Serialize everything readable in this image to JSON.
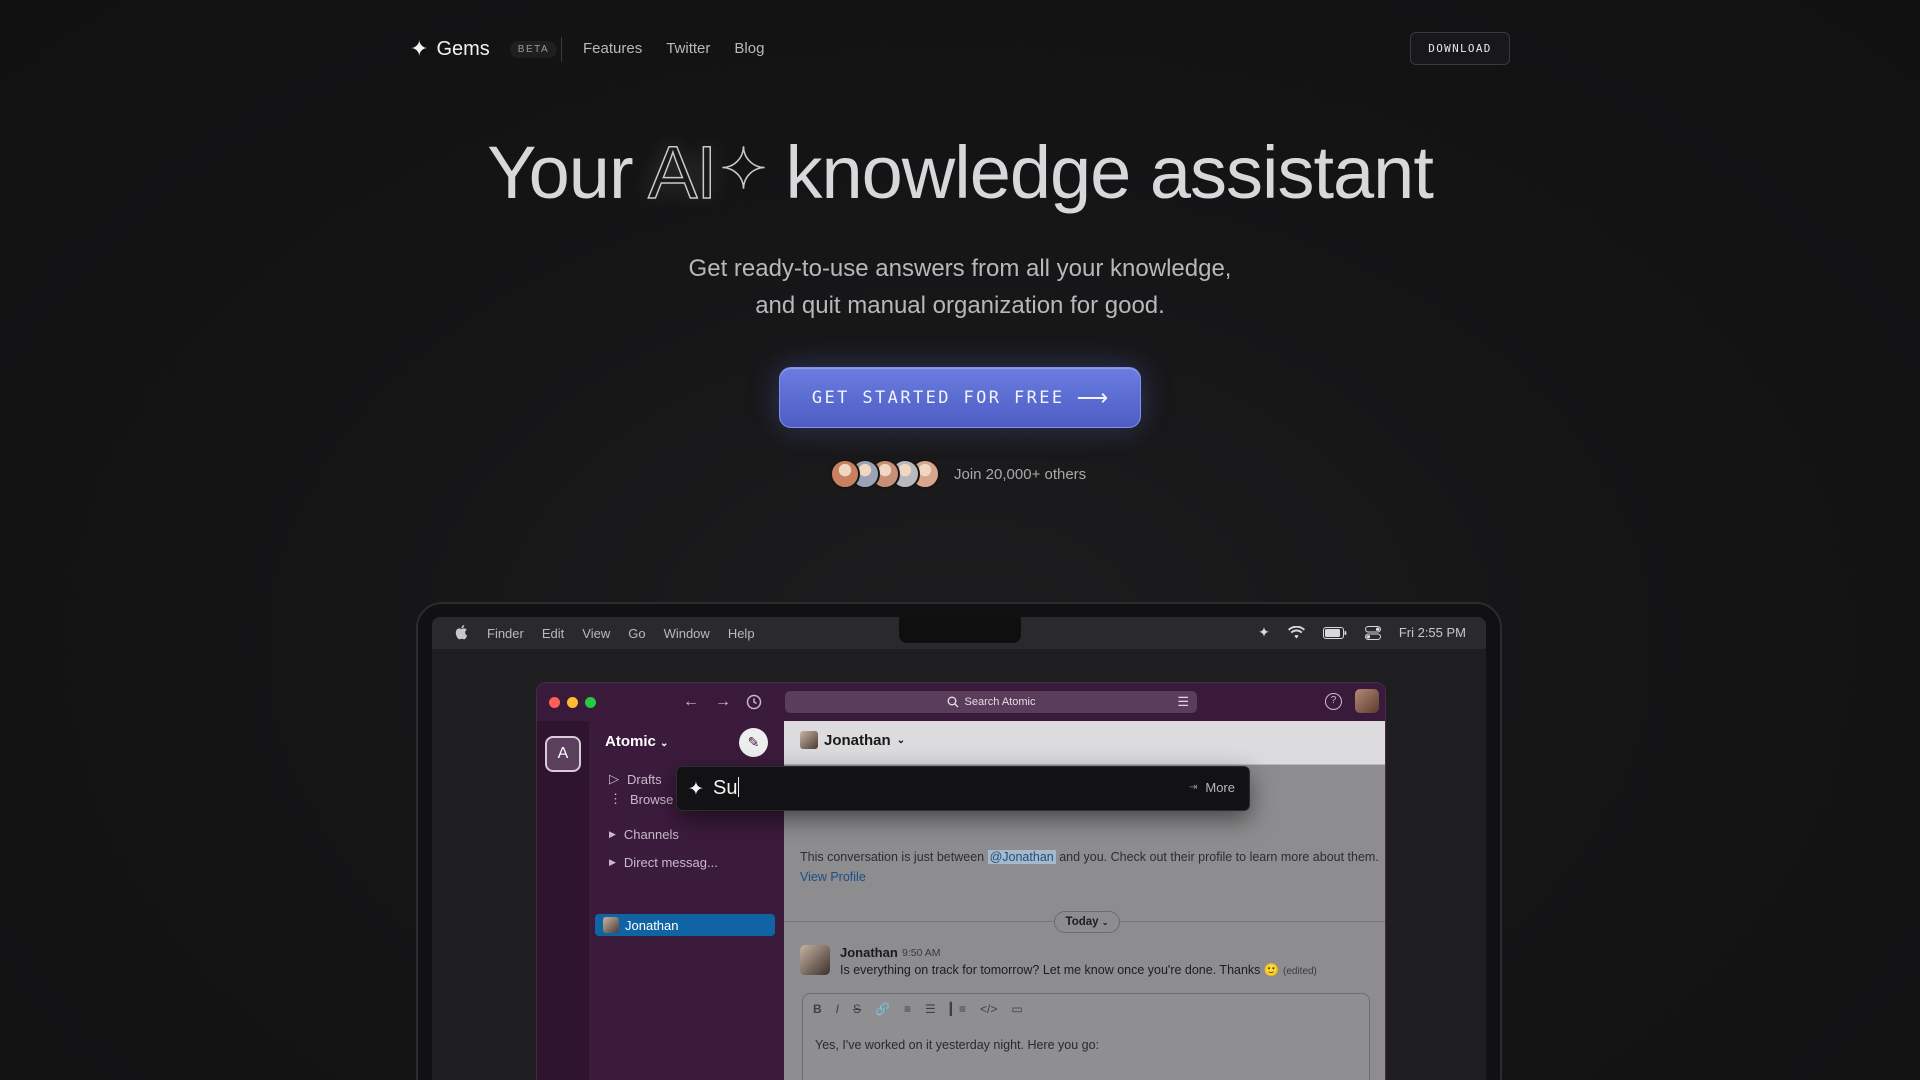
{
  "nav": {
    "brand": "Gems",
    "badge": "BETA",
    "links": [
      "Features",
      "Twitter",
      "Blog"
    ],
    "download": "DOWNLOAD"
  },
  "hero": {
    "title_before": "Your",
    "title_ai": "AI",
    "title_after": "knowledge assistant",
    "subtitle_line1": "Get ready-to-use answers from all your knowledge,",
    "subtitle_line2": "and quit manual organization for good.",
    "cta": "GET STARTED FOR FREE",
    "social_proof": "Join 20,000+ others",
    "avatar_colors": [
      "#c9805f",
      "#9aa3b4",
      "#c98f76",
      "#b9b9bd",
      "#d8a58d"
    ]
  },
  "mac": {
    "menu": [
      "Finder",
      "Edit",
      "View",
      "Go",
      "Window",
      "Help"
    ],
    "time": "Fri 2:55 PM"
  },
  "slack": {
    "search": "Search Atomic",
    "workspace_initial": "A",
    "workspace": "Atomic",
    "sidebar": {
      "drafts": "Drafts",
      "browse": "Browse Slack",
      "channels": "Channels",
      "dms": "Direct messag...",
      "active_dm": "Jonathan"
    },
    "channel": "Jonathan",
    "intro_before": "This conversation is just between ",
    "intro_mention": "@Jonathan",
    "intro_after": " and you. Check out their profile to learn more about them. ",
    "intro_link": "View Profile",
    "today": "Today",
    "message": {
      "author": "Jonathan",
      "time": "9:50 AM",
      "text": "Is everything on track for tomorrow? Let me know once you're done. Thanks",
      "edited": "(edited)"
    },
    "composer_text": "Yes, I've worked on it yesterday night. Here you go:"
  },
  "gems_bar": {
    "input": "Su",
    "more": "More"
  },
  "colors": {
    "cta": "#5b6bd3",
    "slack_purple": "#3b1b3c",
    "slack_active": "#1164a3"
  }
}
